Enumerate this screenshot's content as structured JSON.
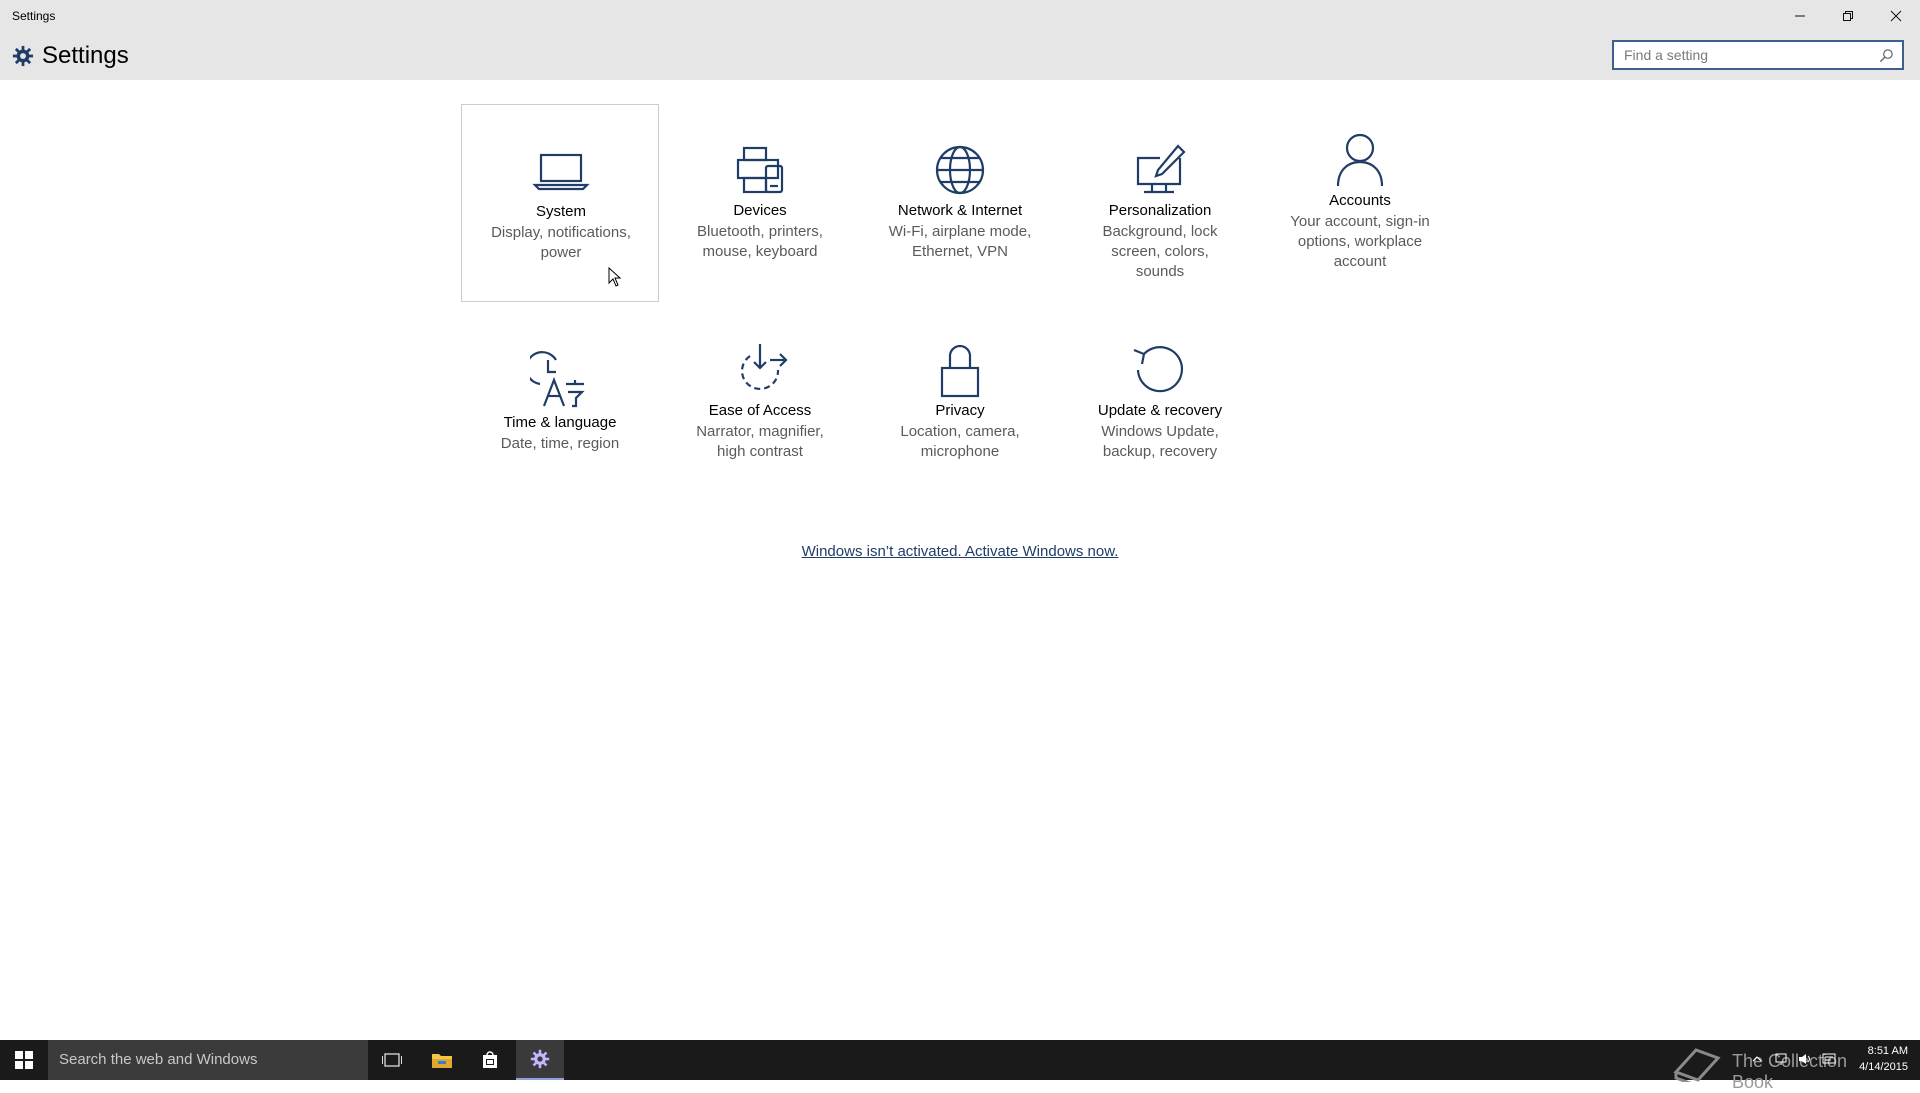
{
  "window": {
    "title": "Settings"
  },
  "header": {
    "title": "Settings",
    "search_placeholder": "Find a setting"
  },
  "tiles": [
    {
      "title": "System",
      "desc": "Display, notifications, power",
      "icon": "laptop-icon",
      "selected": true
    },
    {
      "title": "Devices",
      "desc": "Bluetooth, printers, mouse, keyboard",
      "icon": "devices-icon"
    },
    {
      "title": "Network & Internet",
      "desc": "Wi-Fi, airplane mode, Ethernet, VPN",
      "icon": "globe-icon"
    },
    {
      "title": "Personalization",
      "desc": "Background, lock screen, colors, sounds",
      "icon": "personalization-icon"
    },
    {
      "title": "Accounts",
      "desc": "Your account, sign-in options, workplace account",
      "icon": "person-icon"
    },
    {
      "title": "Time & language",
      "desc": "Date, time, region",
      "icon": "time-language-icon"
    },
    {
      "title": "Ease of Access",
      "desc": "Narrator, magnifier, high contrast",
      "icon": "ease-of-access-icon"
    },
    {
      "title": "Privacy",
      "desc": "Location, camera, microphone",
      "icon": "lock-icon"
    },
    {
      "title": "Update & recovery",
      "desc": "Windows Update, backup, recovery",
      "icon": "refresh-icon"
    }
  ],
  "activation_link": "Windows isn’t activated. Activate Windows now.",
  "taskbar": {
    "search_text": "Search the web and Windows",
    "clock_time": "8:51 AM",
    "clock_date": "4/14/2015",
    "watermark": "The Collection Book"
  },
  "colors": {
    "accent": "#1f3d66",
    "chrome": "#e6e6e6",
    "taskbar": "#1a1a1a"
  }
}
